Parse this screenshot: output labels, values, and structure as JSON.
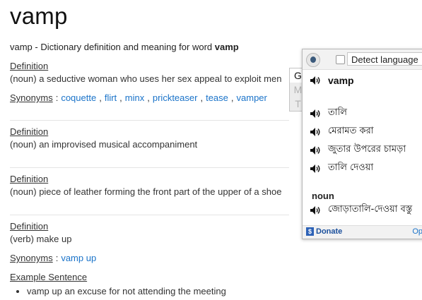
{
  "header": {
    "title": "vamp",
    "intro_prefix": "vamp - Dictionary definition and meaning for word ",
    "intro_word": "vamp"
  },
  "entries": [
    {
      "def_label": "Definition",
      "def_text": "(noun) a seductive woman who uses her sex appeal to exploit men",
      "syn_label": "Synonyms",
      "synonyms": [
        "coquette",
        "flirt",
        "minx",
        "prickteaser",
        "tease",
        "vamper"
      ]
    },
    {
      "def_label": "Definition",
      "def_text": "(noun) an improvised musical accompaniment"
    },
    {
      "def_label": "Definition",
      "def_text": "(noun) piece of leather forming the front part of the upper of a shoe"
    },
    {
      "def_label": "Definition",
      "def_text": "(verb) make up",
      "syn_label": "Synonyms",
      "synonyms": [
        "vamp up"
      ],
      "example_label": "Example Sentence",
      "examples": [
        "vamp up an excuse for not attending the meeting"
      ]
    }
  ],
  "popup": {
    "language_select": "Detect language",
    "gmt": [
      "G",
      "M",
      "T"
    ],
    "source_word": "vamp",
    "translations": [
      "তালি",
      "মেরামত করা",
      "জুতার উপরের চামড়া",
      "তালি দেওয়া"
    ],
    "pos_label": "noun",
    "noun_translations": [
      "জোড়াতালি-দেওয়া বস্তু"
    ],
    "donate_label": "Donate",
    "options_label": "Op",
    "icons": {
      "translator": "globe-icon",
      "speaker": "speaker-icon",
      "donate": "dollar-icon"
    }
  },
  "colors": {
    "link": "#1a73c9",
    "donate": "#1a4f9c"
  }
}
